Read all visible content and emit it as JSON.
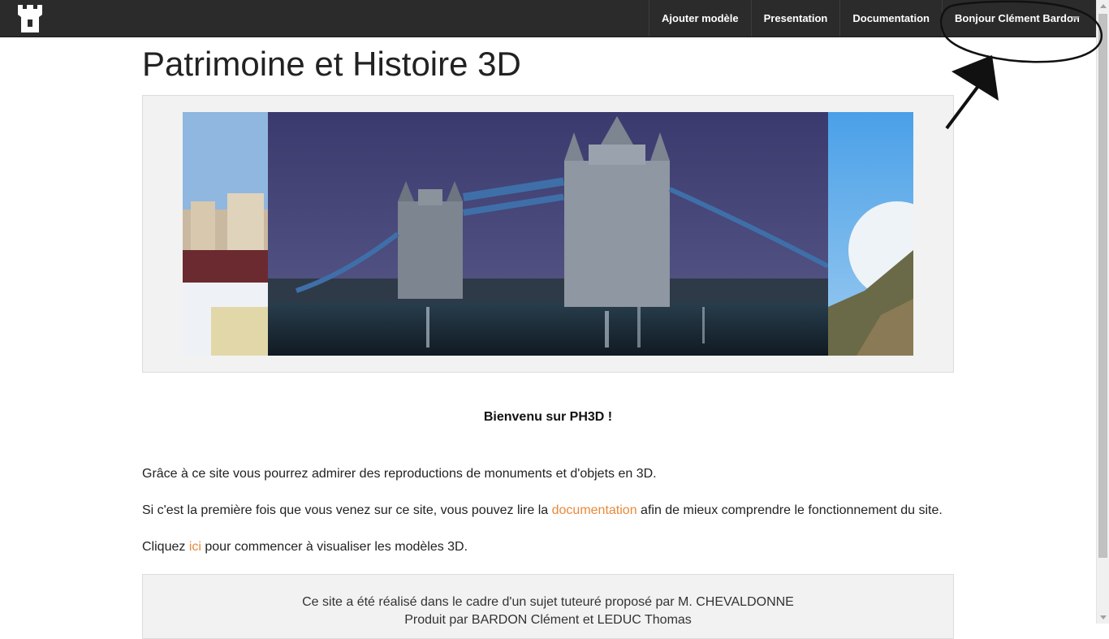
{
  "navbar": {
    "brand_icon": "castle-tower-icon",
    "items": [
      {
        "label": "Ajouter modèle"
      },
      {
        "label": "Presentation"
      },
      {
        "label": "Documentation"
      }
    ],
    "user_label": "Bonjour Clément Bardon"
  },
  "page": {
    "title": "Patrimoine et Histoire 3D"
  },
  "carousel": {
    "description_icon": "tower-bridge-photo"
  },
  "content": {
    "welcome": "Bienvenu sur PH3D !",
    "p1": "Grâce à ce site vous pourrez admirer des reproductions de monuments et d'objets en 3D.",
    "p2_before": "Si c'est la première fois que vous venez sur ce site, vous pouvez lire la ",
    "p2_link": "documentation",
    "p2_after": " afin de mieux comprendre le fonctionnement du site.",
    "p3_before": "Cliquez ",
    "p3_link": "ici",
    "p3_after": " pour commencer à visualiser les modèles 3D."
  },
  "footer": {
    "line1": "Ce site a été réalisé dans le cadre d'un sujet tuteuré proposé par M. CHEVALDONNE",
    "line2": "Produit par BARDON Clément et LEDUC Thomas"
  },
  "colors": {
    "navbar": "#2b2b2b",
    "link": "#e8893a",
    "panel": "#f2f2f2"
  }
}
